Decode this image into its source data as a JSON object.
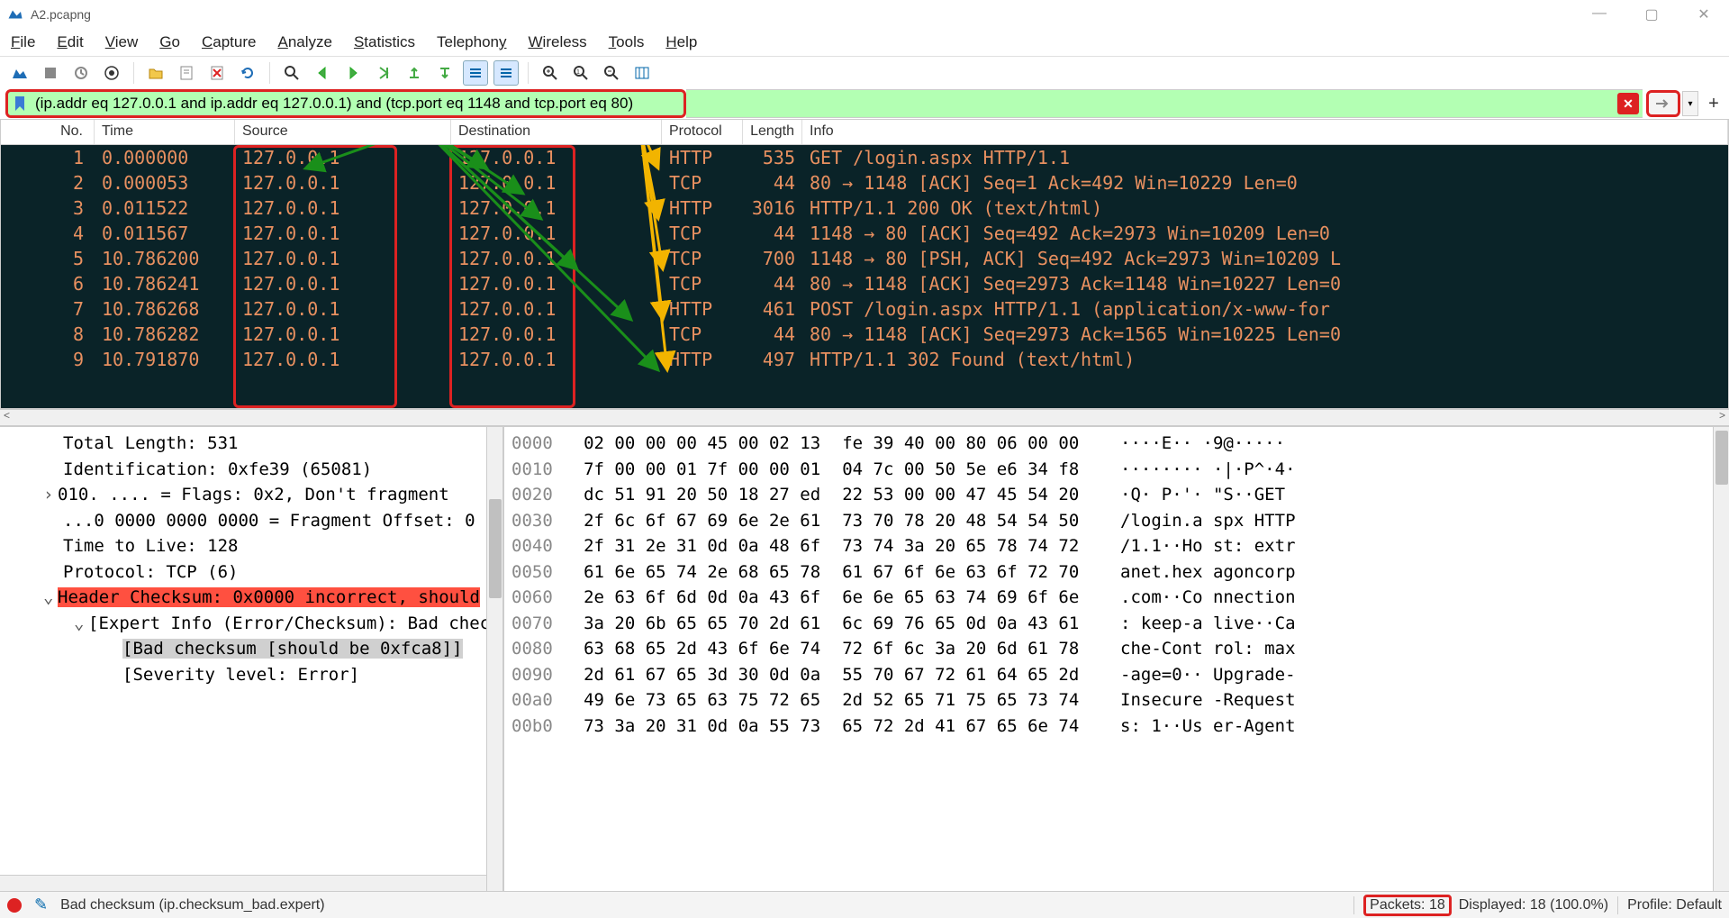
{
  "window": {
    "title": "A2.pcapng"
  },
  "menu": {
    "file": "File",
    "edit": "Edit",
    "view": "View",
    "go": "Go",
    "capture": "Capture",
    "analyze": "Analyze",
    "statistics": "Statistics",
    "telephony": "Telephony",
    "wireless": "Wireless",
    "tools": "Tools",
    "help": "Help"
  },
  "filter": {
    "value": "(ip.addr eq 127.0.0.1 and ip.addr eq 127.0.0.1) and (tcp.port eq 1148 and tcp.port eq 80)"
  },
  "columns": {
    "no": "No.",
    "time": "Time",
    "source": "Source",
    "dest": "Destination",
    "proto": "Protocol",
    "len": "Length",
    "info": "Info"
  },
  "packets": [
    {
      "no": "1",
      "time": "0.000000",
      "src": "127.0.0.1",
      "dst": "127.0.0.1",
      "proto": "HTTP",
      "len": "535",
      "info": "GET /login.aspx HTTP/1.1"
    },
    {
      "no": "2",
      "time": "0.000053",
      "src": "127.0.0.1",
      "dst": "127.0.0.1",
      "proto": "TCP",
      "len": "44",
      "info": "80 → 1148 [ACK] Seq=1 Ack=492 Win=10229 Len=0"
    },
    {
      "no": "3",
      "time": "0.011522",
      "src": "127.0.0.1",
      "dst": "127.0.0.1",
      "proto": "HTTP",
      "len": "3016",
      "info": "HTTP/1.1 200 OK  (text/html)"
    },
    {
      "no": "4",
      "time": "0.011567",
      "src": "127.0.0.1",
      "dst": "127.0.0.1",
      "proto": "TCP",
      "len": "44",
      "info": "1148 → 80 [ACK] Seq=492 Ack=2973 Win=10209 Len=0"
    },
    {
      "no": "5",
      "time": "10.786200",
      "src": "127.0.0.1",
      "dst": "127.0.0.1",
      "proto": "TCP",
      "len": "700",
      "info": "1148 → 80 [PSH, ACK] Seq=492 Ack=2973 Win=10209 L"
    },
    {
      "no": "6",
      "time": "10.786241",
      "src": "127.0.0.1",
      "dst": "127.0.0.1",
      "proto": "TCP",
      "len": "44",
      "info": "80 → 1148 [ACK] Seq=2973 Ack=1148 Win=10227 Len=0"
    },
    {
      "no": "7",
      "time": "10.786268",
      "src": "127.0.0.1",
      "dst": "127.0.0.1",
      "proto": "HTTP",
      "len": "461",
      "info": "POST /login.aspx HTTP/1.1  (application/x-www-for"
    },
    {
      "no": "8",
      "time": "10.786282",
      "src": "127.0.0.1",
      "dst": "127.0.0.1",
      "proto": "TCP",
      "len": "44",
      "info": "80 → 1148 [ACK] Seq=2973 Ack=1565 Win=10225 Len=0"
    },
    {
      "no": "9",
      "time": "10.791870",
      "src": "127.0.0.1",
      "dst": "127.0.0.1",
      "proto": "HTTP",
      "len": "497",
      "info": "HTTP/1.1 302 Found  (text/html)"
    }
  ],
  "details": {
    "l0": "Total Length: 531",
    "l1": "Identification: 0xfe39 (65081)",
    "l2": "010. .... = Flags: 0x2, Don't fragment",
    "l3": "...0 0000 0000 0000 = Fragment Offset: 0",
    "l4": "Time to Live: 128",
    "l5": "Protocol: TCP (6)",
    "l6": "Header Checksum: 0x0000 incorrect, should",
    "l7": "[Expert Info (Error/Checksum): Bad chec",
    "l8": "[Bad checksum [should be 0xfca8]]",
    "l9": "[Severity level: Error]"
  },
  "hex": [
    {
      "off": "0000",
      "h1": "02 00 00 00 45 00 02 13",
      "h2": "fe 39 40 00 80 06 00 00",
      "a": "····E·· ·9@·····"
    },
    {
      "off": "0010",
      "h1": "7f 00 00 01 7f 00 00 01",
      "h2": "04 7c 00 50 5e e6 34 f8",
      "a": "········ ·|·P^·4·"
    },
    {
      "off": "0020",
      "h1": "dc 51 91 20 50 18 27 ed",
      "h2": "22 53 00 00 47 45 54 20",
      "a": "·Q· P·'· \"S··GET "
    },
    {
      "off": "0030",
      "h1": "2f 6c 6f 67 69 6e 2e 61",
      "h2": "73 70 78 20 48 54 54 50",
      "a": "/login.a spx HTTP"
    },
    {
      "off": "0040",
      "h1": "2f 31 2e 31 0d 0a 48 6f",
      "h2": "73 74 3a 20 65 78 74 72",
      "a": "/1.1··Ho st: extr"
    },
    {
      "off": "0050",
      "h1": "61 6e 65 74 2e 68 65 78",
      "h2": "61 67 6f 6e 63 6f 72 70",
      "a": "anet.hex agoncorp"
    },
    {
      "off": "0060",
      "h1": "2e 63 6f 6d 0d 0a 43 6f",
      "h2": "6e 6e 65 63 74 69 6f 6e",
      "a": ".com··Co nnection"
    },
    {
      "off": "0070",
      "h1": "3a 20 6b 65 65 70 2d 61",
      "h2": "6c 69 76 65 0d 0a 43 61",
      "a": ": keep-a live··Ca"
    },
    {
      "off": "0080",
      "h1": "63 68 65 2d 43 6f 6e 74",
      "h2": "72 6f 6c 3a 20 6d 61 78",
      "a": "che-Cont rol: max"
    },
    {
      "off": "0090",
      "h1": "2d 61 67 65 3d 30 0d 0a",
      "h2": "55 70 67 72 61 64 65 2d",
      "a": "-age=0·· Upgrade-"
    },
    {
      "off": "00a0",
      "h1": "49 6e 73 65 63 75 72 65",
      "h2": "2d 52 65 71 75 65 73 74",
      "a": "Insecure -Request"
    },
    {
      "off": "00b0",
      "h1": "73 3a 20 31 0d 0a 55 73",
      "h2": "65 72 2d 41 67 65 6e 74",
      "a": "s: 1··Us er-Agent"
    }
  ],
  "status": {
    "msg": "Bad checksum (ip.checksum_bad.expert)",
    "packets": "Packets: 18",
    "displayed": "Displayed: 18 (100.0%)",
    "profile": "Profile: Default"
  }
}
